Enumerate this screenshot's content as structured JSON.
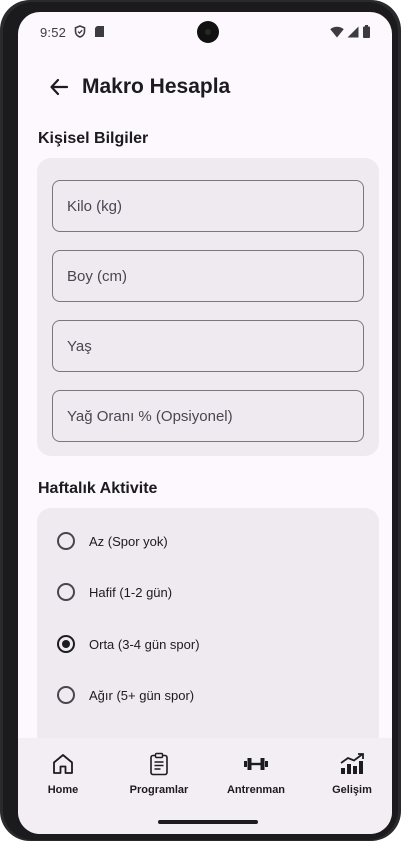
{
  "status_bar": {
    "time": "9:52",
    "left_icons": [
      "shield-icon",
      "sd-card-icon"
    ],
    "right_icons": [
      "wifi-icon",
      "cellular-icon",
      "battery-icon"
    ]
  },
  "app_bar": {
    "title": "Makro Hesapla",
    "back_icon": "arrow-left-icon"
  },
  "personal_info": {
    "title": "Kişisel Bilgiler",
    "fields": [
      {
        "placeholder": "Kilo (kg)",
        "value": ""
      },
      {
        "placeholder": "Boy (cm)",
        "value": ""
      },
      {
        "placeholder": "Yaş",
        "value": ""
      },
      {
        "placeholder": "Yağ Oranı % (Opsiyonel)",
        "value": ""
      }
    ]
  },
  "activity": {
    "title": "Haftalık Aktivite",
    "selected": "Orta (3-4 gün spor)",
    "options": [
      {
        "label": "Az (Spor yok)",
        "checked": false
      },
      {
        "label": "Hafif (1-2 gün)",
        "checked": false
      },
      {
        "label": "Orta (3-4 gün spor)",
        "checked": true
      },
      {
        "label": "Ağır (5+ gün spor)",
        "checked": false
      }
    ]
  },
  "bottom_nav": {
    "items": [
      {
        "label": "Home",
        "icon": "home-icon"
      },
      {
        "label": "Programlar",
        "icon": "clipboard-icon"
      },
      {
        "label": "Antrenman",
        "icon": "dumbbell-icon"
      },
      {
        "label": "Gelişim",
        "icon": "chart-icon"
      }
    ]
  },
  "colors": {
    "background": "#fdf7fe",
    "card": "#efe9f0",
    "nav": "#f3edf4",
    "text": "#1c1b1f",
    "outline": "#7a757f"
  }
}
